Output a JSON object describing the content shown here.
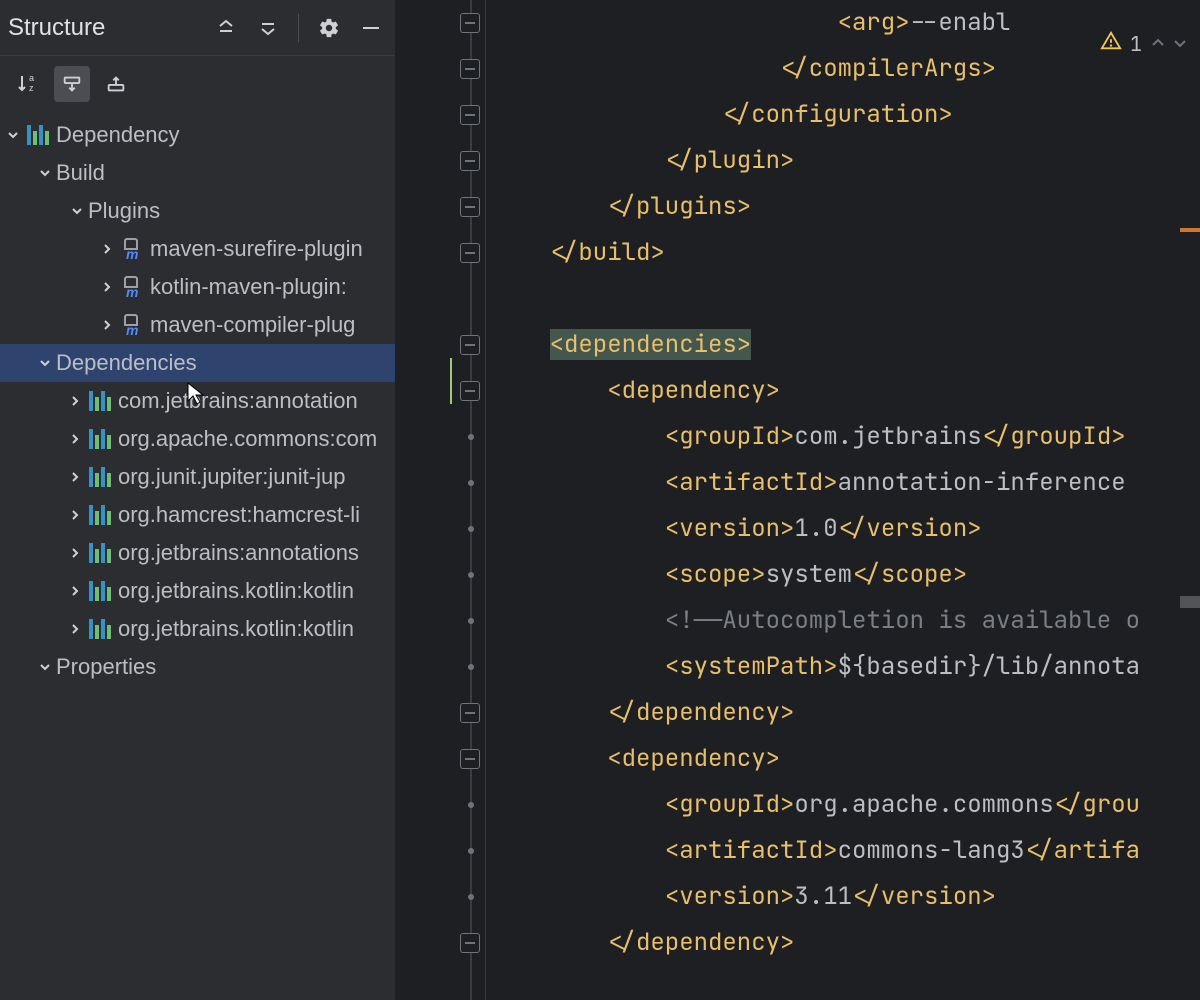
{
  "structure": {
    "title": "Structure",
    "tree": {
      "root": "Dependency",
      "build": "Build",
      "plugins": "Plugins",
      "pluginItems": [
        "maven-surefire-plugin",
        "kotlin-maven-plugin:",
        "maven-compiler-plug"
      ],
      "dependencies": "Dependencies",
      "depItems": [
        "com.jetbrains:annotation",
        "org.apache.commons:com",
        "org.junit.jupiter:junit-jup",
        "org.hamcrest:hamcrest-li",
        "org.jetbrains:annotations",
        "org.jetbrains.kotlin:kotlin",
        "org.jetbrains.kotlin:kotlin"
      ],
      "properties": "Properties"
    }
  },
  "inspections": {
    "count": "1"
  },
  "code": {
    "l1_pre": "                        ",
    "l1_tag_open": "<arg>",
    "l1_text": "--enabl",
    "l2_pre": "                    ",
    "l2_close": "</compilerArgs>",
    "l3_pre": "                ",
    "l3_close": "</configuration>",
    "l4_pre": "            ",
    "l4_close": "</plugin>",
    "l5_pre": "        ",
    "l5_close": "</plugins>",
    "l6_pre": "    ",
    "l6_close": "</build>",
    "l8_pre": "    ",
    "l8_open": "<dependencies>",
    "l9_pre": "        ",
    "l9_open": "<dependency>",
    "l10_pre": "            ",
    "l10_tag": "<groupId>",
    "l10_val": "com.jetbrains",
    "l10_close": "</groupId>",
    "l11_pre": "            ",
    "l11_tag": "<artifactId>",
    "l11_val": "annotation-inference",
    "l12_pre": "            ",
    "l12_tag": "<version>",
    "l12_val": "1.0",
    "l12_close": "</version>",
    "l13_pre": "            ",
    "l13_tag": "<scope>",
    "l13_val": "system",
    "l13_close": "</scope>",
    "l14_pre": "            ",
    "l14_comment": "<!——Autocompletion is available o",
    "l15_pre": "            ",
    "l15_tag": "<systemPath>",
    "l15_val": "${basedir}/lib/annota",
    "l16_pre": "        ",
    "l16_close": "</dependency>",
    "l17_pre": "        ",
    "l17_open": "<dependency>",
    "l18_pre": "            ",
    "l18_tag": "<groupId>",
    "l18_val": "org.apache.commons",
    "l18_close": "</grou",
    "l19_pre": "            ",
    "l19_tag": "<artifactId>",
    "l19_val": "commons-lang3",
    "l19_close": "</artifa",
    "l20_pre": "            ",
    "l20_tag": "<version>",
    "l20_val": "3.11",
    "l20_close": "</version>",
    "l21_pre": "        ",
    "l21_close": "</dependency>"
  }
}
